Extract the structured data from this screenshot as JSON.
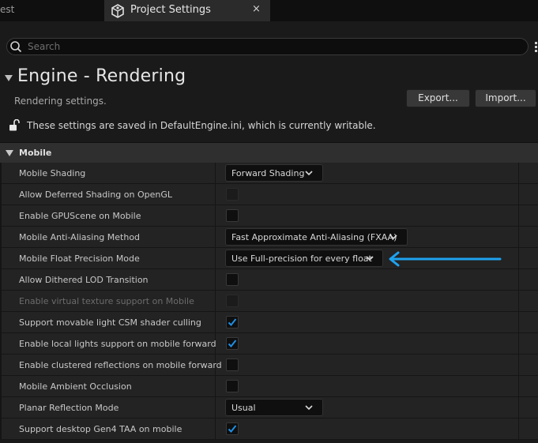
{
  "tabs": {
    "prev_label": "est",
    "active_label": "Project Settings",
    "close_glyph": "×"
  },
  "search": {
    "placeholder": "Search",
    "value": ""
  },
  "header": {
    "title": "Engine - Rendering",
    "description": "Rendering settings.",
    "export_label": "Export...",
    "import_label": "Import...",
    "writable_notice": "These settings are saved in DefaultEngine.ini, which is currently writable."
  },
  "section": {
    "label": "Mobile",
    "rows": [
      {
        "label": "Mobile Shading",
        "type": "dropdown",
        "value": "Forward Shading"
      },
      {
        "label": "Allow Deferred Shading on OpenGL",
        "type": "checkbox",
        "checked": false,
        "disabled": true
      },
      {
        "label": "Enable GPUScene on Mobile",
        "type": "checkbox",
        "checked": false
      },
      {
        "label": "Mobile Anti-Aliasing Method",
        "type": "dropdown",
        "value": "Fast Approximate Anti-Aliasing (FXAA)"
      },
      {
        "label": "Mobile Float Precision Mode",
        "type": "dropdown",
        "value": "Use Full-precision for every float"
      },
      {
        "label": "Allow Dithered LOD Transition",
        "type": "checkbox",
        "checked": false
      },
      {
        "label": "Enable virtual texture support on Mobile",
        "type": "checkbox",
        "checked": false,
        "disabled": true
      },
      {
        "label": "Support movable light CSM shader culling",
        "type": "checkbox",
        "checked": true
      },
      {
        "label": "Enable local lights support on mobile forward",
        "type": "checkbox",
        "checked": true
      },
      {
        "label": "Enable clustered reflections on mobile forward",
        "type": "checkbox",
        "checked": false
      },
      {
        "label": "Mobile Ambient Occlusion",
        "type": "checkbox",
        "checked": false
      },
      {
        "label": "Planar Reflection Mode",
        "type": "dropdown",
        "value": "Usual"
      },
      {
        "label": "Support desktop Gen4 TAA on mobile",
        "type": "checkbox",
        "checked": true
      }
    ]
  },
  "colors": {
    "accent": "#26bbff",
    "checkmark": "#1f8fe6",
    "annotation_arrow": "#1ea3f0"
  },
  "icons": {
    "tab": "settings-cube-icon",
    "search": "search-icon",
    "options": "vertical-dots-icon",
    "collapse": "triangle-down-icon",
    "lock": "unlocked-padlock-icon",
    "dropdown": "chevron-down-icon",
    "check": "checkmark-icon",
    "annotation": "left-arrow-icon"
  }
}
